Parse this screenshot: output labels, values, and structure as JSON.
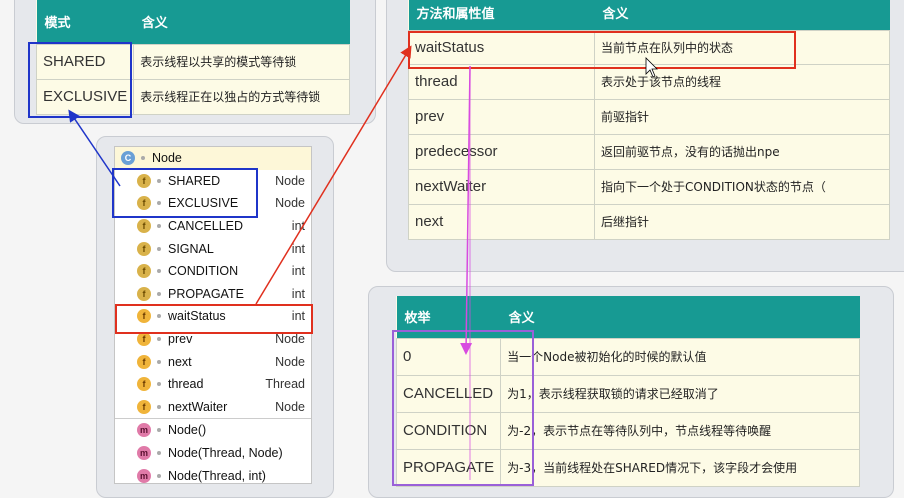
{
  "table_mode": {
    "headers": [
      "模式",
      "含义"
    ],
    "rows": [
      [
        "SHARED",
        "表示线程以共享的模式等待锁"
      ],
      [
        "EXCLUSIVE",
        "表示线程正在以独占的方式等待锁"
      ]
    ]
  },
  "table_methods": {
    "headers": [
      "方法和属性值",
      "含义"
    ],
    "rows": [
      [
        "waitStatus",
        "当前节点在队列中的状态"
      ],
      [
        "thread",
        "表示处于该节点的线程"
      ],
      [
        "prev",
        "前驱指针"
      ],
      [
        "predecessor",
        "返回前驱节点，没有的话抛出npe"
      ],
      [
        "nextWaiter",
        "指向下一个处于CONDITION状态的节点（"
      ],
      [
        "next",
        "后继指针"
      ]
    ]
  },
  "table_enum": {
    "headers": [
      "枚举",
      "含义"
    ],
    "rows": [
      [
        "0",
        "当一个Node被初始化的时候的默认值"
      ],
      [
        "CANCELLED",
        "为1，表示线程获取锁的请求已经取消了"
      ],
      [
        "CONDITION",
        "为-2，表示节点在等待队列中，节点线程等待唤醒"
      ],
      [
        "PROPAGATE",
        "为-3，当前线程处在SHARED情况下，该字段才会使用"
      ]
    ]
  },
  "structure": {
    "class_name": "Node",
    "items": [
      {
        "icon": "sf",
        "name": "SHARED",
        "type": "Node"
      },
      {
        "icon": "sf",
        "name": "EXCLUSIVE",
        "type": "Node"
      },
      {
        "icon": "sf",
        "name": "CANCELLED",
        "type": "int"
      },
      {
        "icon": "sf",
        "name": "SIGNAL",
        "type": "int"
      },
      {
        "icon": "sf",
        "name": "CONDITION",
        "type": "int"
      },
      {
        "icon": "sf",
        "name": "PROPAGATE",
        "type": "int"
      },
      {
        "icon": "f",
        "name": "waitStatus",
        "type": "int"
      },
      {
        "icon": "f",
        "name": "prev",
        "type": "Node"
      },
      {
        "icon": "f",
        "name": "next",
        "type": "Node"
      },
      {
        "icon": "f",
        "name": "thread",
        "type": "Thread"
      },
      {
        "icon": "f",
        "name": "nextWaiter",
        "type": "Node"
      },
      {
        "icon": "m",
        "name": "Node()",
        "type": ""
      },
      {
        "icon": "m",
        "name": "Node(Thread, Node)",
        "type": ""
      },
      {
        "icon": "m",
        "name": "Node(Thread, int)",
        "type": ""
      }
    ]
  },
  "colors": {
    "teal": "#179a93",
    "blue_box": "#1f35c9",
    "red_box": "#e0301e",
    "magenta": "#d84ae0",
    "purple_box": "#9a60d8"
  }
}
